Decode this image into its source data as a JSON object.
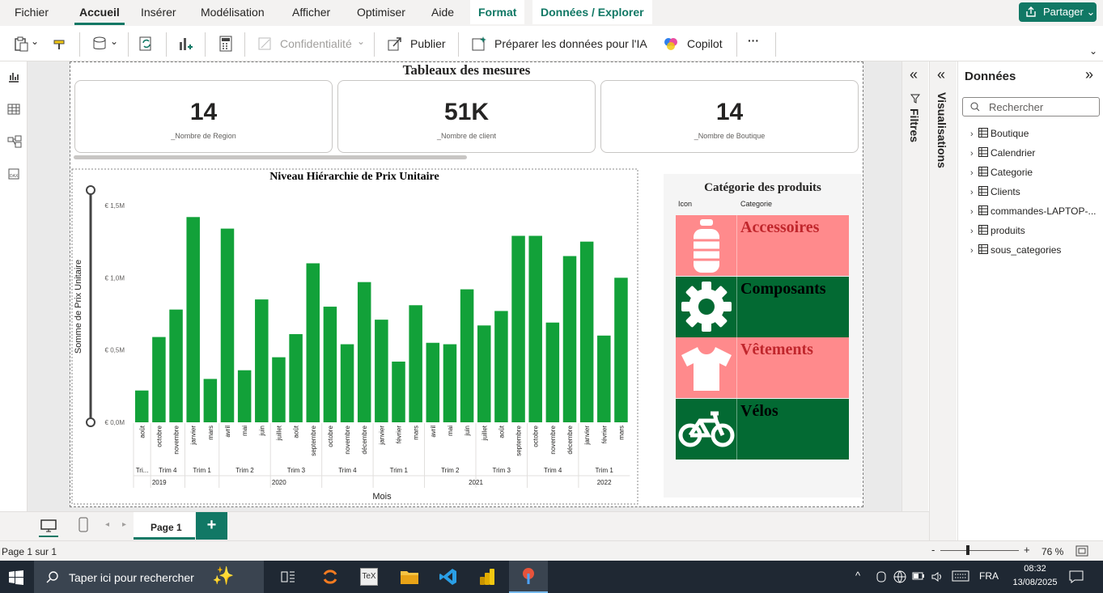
{
  "menu": {
    "items": [
      "Fichier",
      "Accueil",
      "Insérer",
      "Modélisation",
      "Afficher",
      "Optimiser",
      "Aide",
      "Format",
      "Données / Explorer"
    ],
    "share": "Partager"
  },
  "ribbon": {
    "confidentiality": "Confidentialité",
    "publish": "Publier",
    "prepare_ai": "Préparer les données pour l'IA",
    "copilot": "Copilot",
    "more": "···"
  },
  "report": {
    "title": "Tableaux des mesures"
  },
  "cards": [
    {
      "value": "14",
      "label": "_Nombre de Region"
    },
    {
      "value": "51K",
      "label": "_Nombre de client"
    },
    {
      "value": "14",
      "label": "_Nombre de Boutique"
    }
  ],
  "chart_data": {
    "type": "bar",
    "title": "Niveau Hiérarchie de Prix Unitaire",
    "xlabel": "Mois",
    "ylabel": "Somme de Prix Unitaire",
    "yticks": [
      "€ 0,0M",
      "€ 0,5M",
      "€ 1,0M",
      "€ 1,5M"
    ],
    "ylim": [
      0,
      1.5
    ],
    "color": "#12a139",
    "categories": [
      "août",
      "octobre",
      "novembre",
      "janvier",
      "mars",
      "avril",
      "mai",
      "juin",
      "juillet",
      "août",
      "septembre",
      "octobre",
      "novembre",
      "décembre",
      "janvier",
      "février",
      "mars",
      "avril",
      "mai",
      "juin",
      "juillet",
      "août",
      "septembre",
      "octobre",
      "novembre",
      "décembre",
      "janvier",
      "février",
      "mars"
    ],
    "values": [
      0.22,
      0.59,
      0.78,
      1.42,
      0.3,
      1.34,
      0.36,
      0.85,
      0.45,
      0.61,
      1.1,
      0.8,
      0.54,
      0.97,
      0.71,
      0.42,
      0.81,
      0.55,
      0.54,
      0.92,
      0.67,
      0.77,
      1.29,
      1.29,
      0.69,
      1.15,
      1.25,
      0.6,
      1.0
    ],
    "quarters": [
      {
        "label": "Tri...",
        "span": 1
      },
      {
        "label": "Trim 4",
        "span": 2
      },
      {
        "label": "Trim 1",
        "span": 2
      },
      {
        "label": "Trim 2",
        "span": 3
      },
      {
        "label": "Trim 3",
        "span": 3
      },
      {
        "label": "Trim 4",
        "span": 3
      },
      {
        "label": "Trim 1",
        "span": 3
      },
      {
        "label": "Trim 2",
        "span": 3
      },
      {
        "label": "Trim 3",
        "span": 3
      },
      {
        "label": "Trim 4",
        "span": 3
      },
      {
        "label": "Trim 1",
        "span": 3
      }
    ],
    "years": [
      {
        "label": "2019",
        "span": 3
      },
      {
        "label": "2020",
        "span": 11
      },
      {
        "label": "2021",
        "span": 12
      },
      {
        "label": "2022",
        "span": 3
      }
    ]
  },
  "categories_table": {
    "title": "Catégorie des produits",
    "col_icon": "Icon",
    "col_cat": "Categorie",
    "rows": [
      {
        "name": "Accessoires",
        "icon": "bottle-icon",
        "bg": "#ff8a8c",
        "fg": "#c0262c"
      },
      {
        "name": "Composants",
        "icon": "gear-icon",
        "bg": "#036a33",
        "fg": "#000000"
      },
      {
        "name": "Vêtements",
        "icon": "shirt-icon",
        "bg": "#ff8a8c",
        "fg": "#c0262c"
      },
      {
        "name": "Vélos",
        "icon": "bike-icon",
        "bg": "#036a33",
        "fg": "#000000"
      }
    ]
  },
  "panes": {
    "filters": "Filtres",
    "visualizations": "Visualisations",
    "data_title": "Données",
    "search_placeholder": "Rechercher",
    "tables": [
      "Boutique",
      "Calendrier",
      "Categorie",
      "Clients",
      "commandes-LAPTOP-...",
      "produits",
      "sous_categories"
    ]
  },
  "pages": {
    "current": "Page 1",
    "add": "+"
  },
  "status": {
    "page_info": "Page 1 sur 1",
    "zoom": "76 %",
    "zoom_minus": "-",
    "zoom_plus": "+"
  },
  "taskbar": {
    "search": "Taper ici pour rechercher",
    "lang": "FRA",
    "time": "08:32",
    "date": "13/08/2025"
  }
}
